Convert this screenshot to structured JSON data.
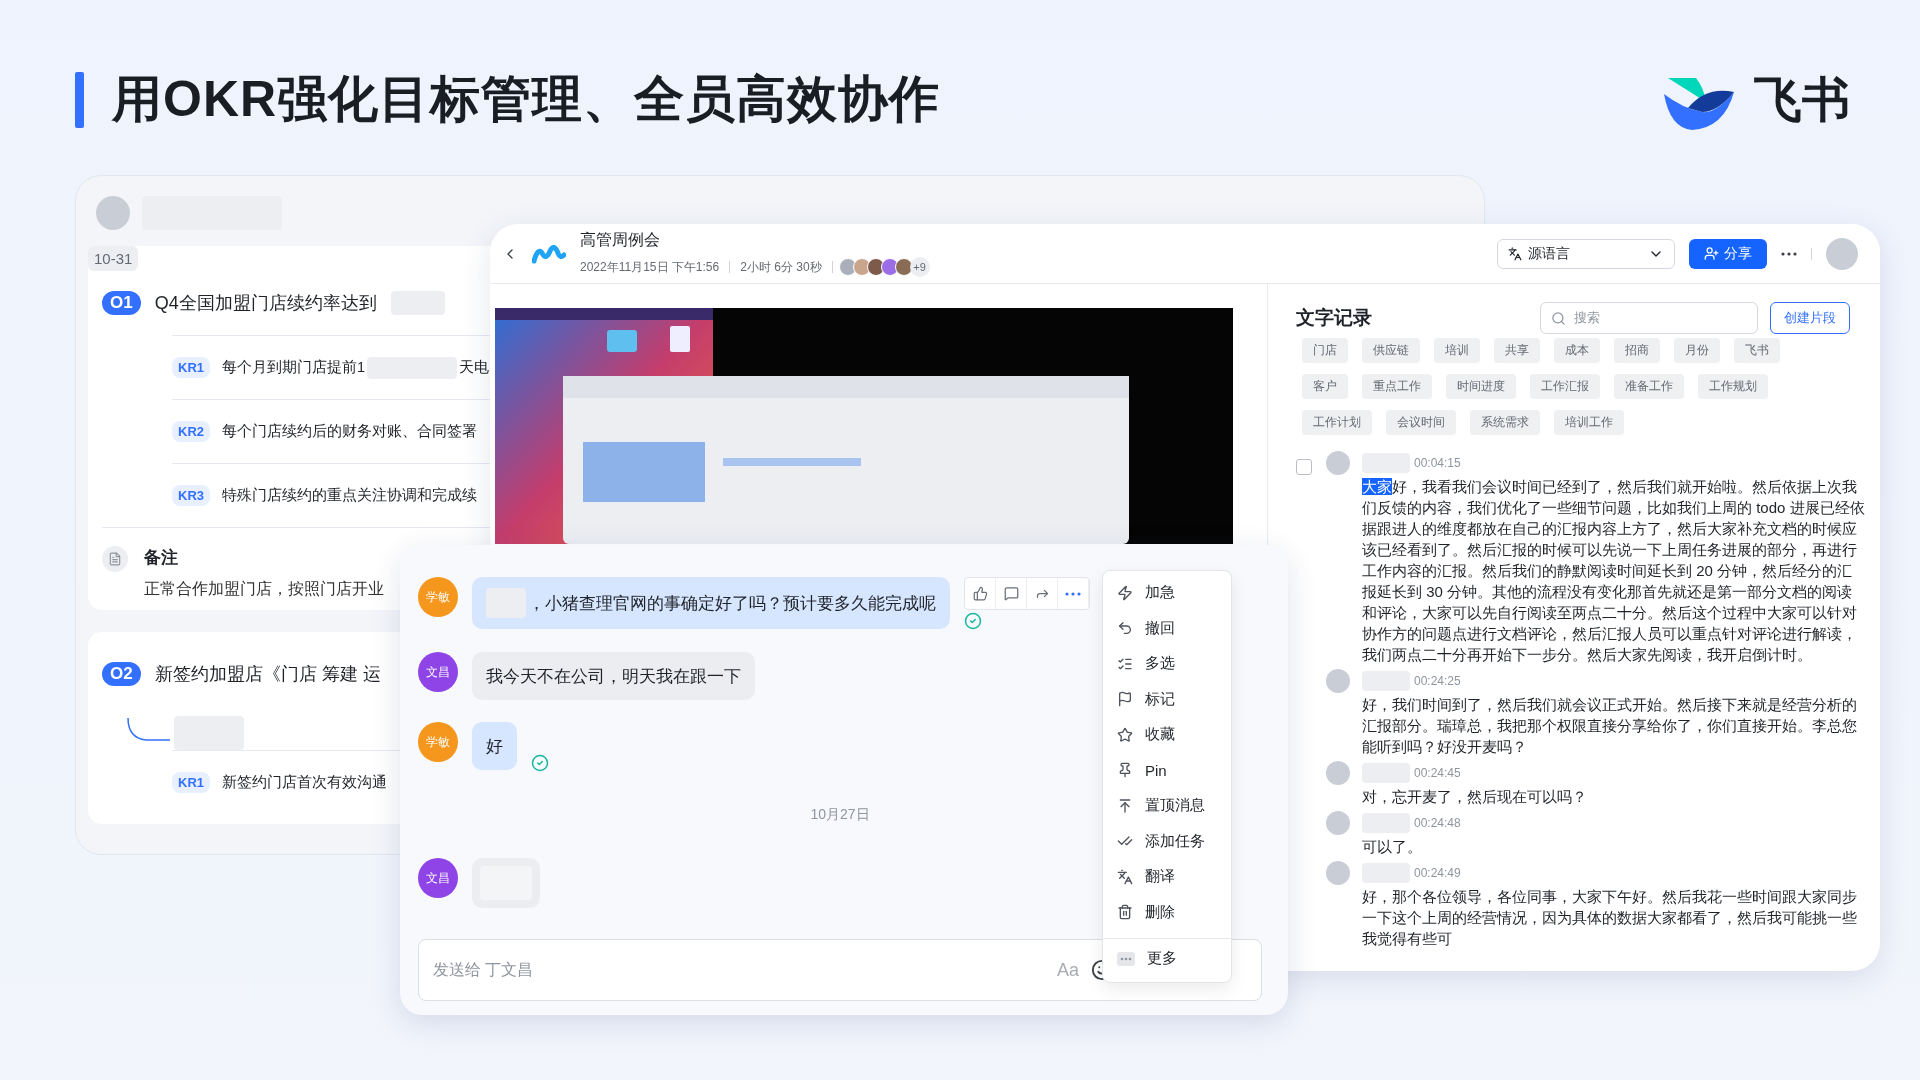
{
  "page_title": "用OKR强化目标管理、全员高效协作",
  "brand": {
    "name": "飞书"
  },
  "okr_window": {
    "date": "10-31",
    "objectives": [
      {
        "badge": "O1",
        "title": "Q4全国加盟门店续约率达到",
        "title_redacted": true,
        "extra_line_redacted": false,
        "key_results": [
          {
            "badge": "KR1",
            "text": "每个月到期门店提前1",
            "text_after": "天电"
          },
          {
            "badge": "KR2",
            "text": "每个门店续约后的财务对账、合同签署"
          },
          {
            "badge": "KR3",
            "text": "特殊门店续约的重点关注协调和完成续"
          }
        ],
        "note": {
          "label": "备注",
          "text": "正常合作加盟门店，按照门店开业"
        }
      },
      {
        "badge": "O2",
        "title": "新签约加盟店《门店 筹建 运",
        "title_redacted": false,
        "extra_line_redacted": true,
        "key_results": [
          {
            "badge": "KR1",
            "text": "新签约门店首次有效沟通"
          }
        ]
      }
    ]
  },
  "meeting_window": {
    "title": "高管周例会",
    "date": "2022年11月15日 下午1:56",
    "duration": "2小时 6分 30秒",
    "more_participants": "+9",
    "language_select": "源语言",
    "share_button": "分享",
    "transcript": {
      "title": "文字记录",
      "search_placeholder": "搜索",
      "create_button": "创建片段",
      "tags": [
        "门店",
        "供应链",
        "培训",
        "共享",
        "成本",
        "招商",
        "月份",
        "飞书",
        "客户",
        "重点工作",
        "时间进度",
        "工作汇报",
        "准备工作",
        "工作规划",
        "工作计划",
        "会议时间",
        "系统需求",
        "培训工作"
      ],
      "entries": [
        {
          "time": "00:04:15",
          "kind": "with_checkbox",
          "checked": false,
          "highlight": "大家",
          "text": "好，我看我们会议时间已经到了，然后我们就开始啦。然后依据上次我们反馈的内容，我们优化了一些细节问题，比如我们上周的 todo 进展已经依据跟进人的维度都放在自己的汇报内容上方了，然后大家补充文档的时候应该已经看到了。然后汇报的时候可以先说一下上周任务进展的部分，再进行工作内容的汇报。然后我们的静默阅读时间延长到 20 分钟，然后经分的汇报延长到 30 分钟。其他的流程没有变化那首先就还是第一部分文档的阅读和评论，大家可以先自行阅读至两点二十分。然后这个过程中大家可以针对协作方的问题点进行文档评论，然后汇报人员可以重点针对评论进行解读，我们两点二十分再开始下一步分。然后大家先阅读，我开启倒计时。"
        },
        {
          "time": "00:24:25",
          "kind": "plain",
          "text": "好，我们时间到了，然后我们就会议正式开始。然后接下来就是经营分析的汇报部分。瑞璋总，我把那个权限直接分享给你了，你们直接开始。李总您能听到吗？好没开麦吗？"
        },
        {
          "time": "00:24:45",
          "kind": "plain",
          "text": "对，忘开麦了，然后现在可以吗？"
        },
        {
          "time": "00:24:48",
          "kind": "plain",
          "text": "可以了。"
        },
        {
          "time": "00:24:49",
          "kind": "plain",
          "text": "好，那个各位领导，各位同事，大家下午好。然后我花一些时间跟大家同步一下这个上周的经营情况，因为具体的数据大家都看了，然后我可能挑一些我觉得有些可"
        }
      ]
    }
  },
  "chat_window": {
    "messages": [
      {
        "kind": "message",
        "sender": "学敏",
        "color": "#f5961d",
        "redacted_prefix": true,
        "text": "，小猪查理官网的事确定好了吗？预计要多久能完成呢",
        "read": true,
        "hovered": true,
        "mine": true
      },
      {
        "kind": "message",
        "sender": "文昌",
        "color": "#8e44e6",
        "redacted_prefix": false,
        "text": "我今天不在公司，明天我在跟一下",
        "read": false,
        "hovered": false,
        "mine": false
      },
      {
        "kind": "message",
        "sender": "学敏",
        "color": "#f5961d",
        "redacted_prefix": false,
        "text": "好",
        "read": true,
        "hovered": false,
        "mine": true
      },
      {
        "kind": "date",
        "text": "10月27日"
      },
      {
        "kind": "blank",
        "sender": "文昌",
        "color": "#8e44e6"
      }
    ],
    "input": {
      "placeholder": "发送给 丁文昌",
      "format_label": "Aa"
    },
    "menu": [
      "加急",
      "撤回",
      "多选",
      "标记",
      "收藏",
      "Pin",
      "置顶消息",
      "添加任务",
      "翻译",
      "删除",
      "更多"
    ]
  }
}
